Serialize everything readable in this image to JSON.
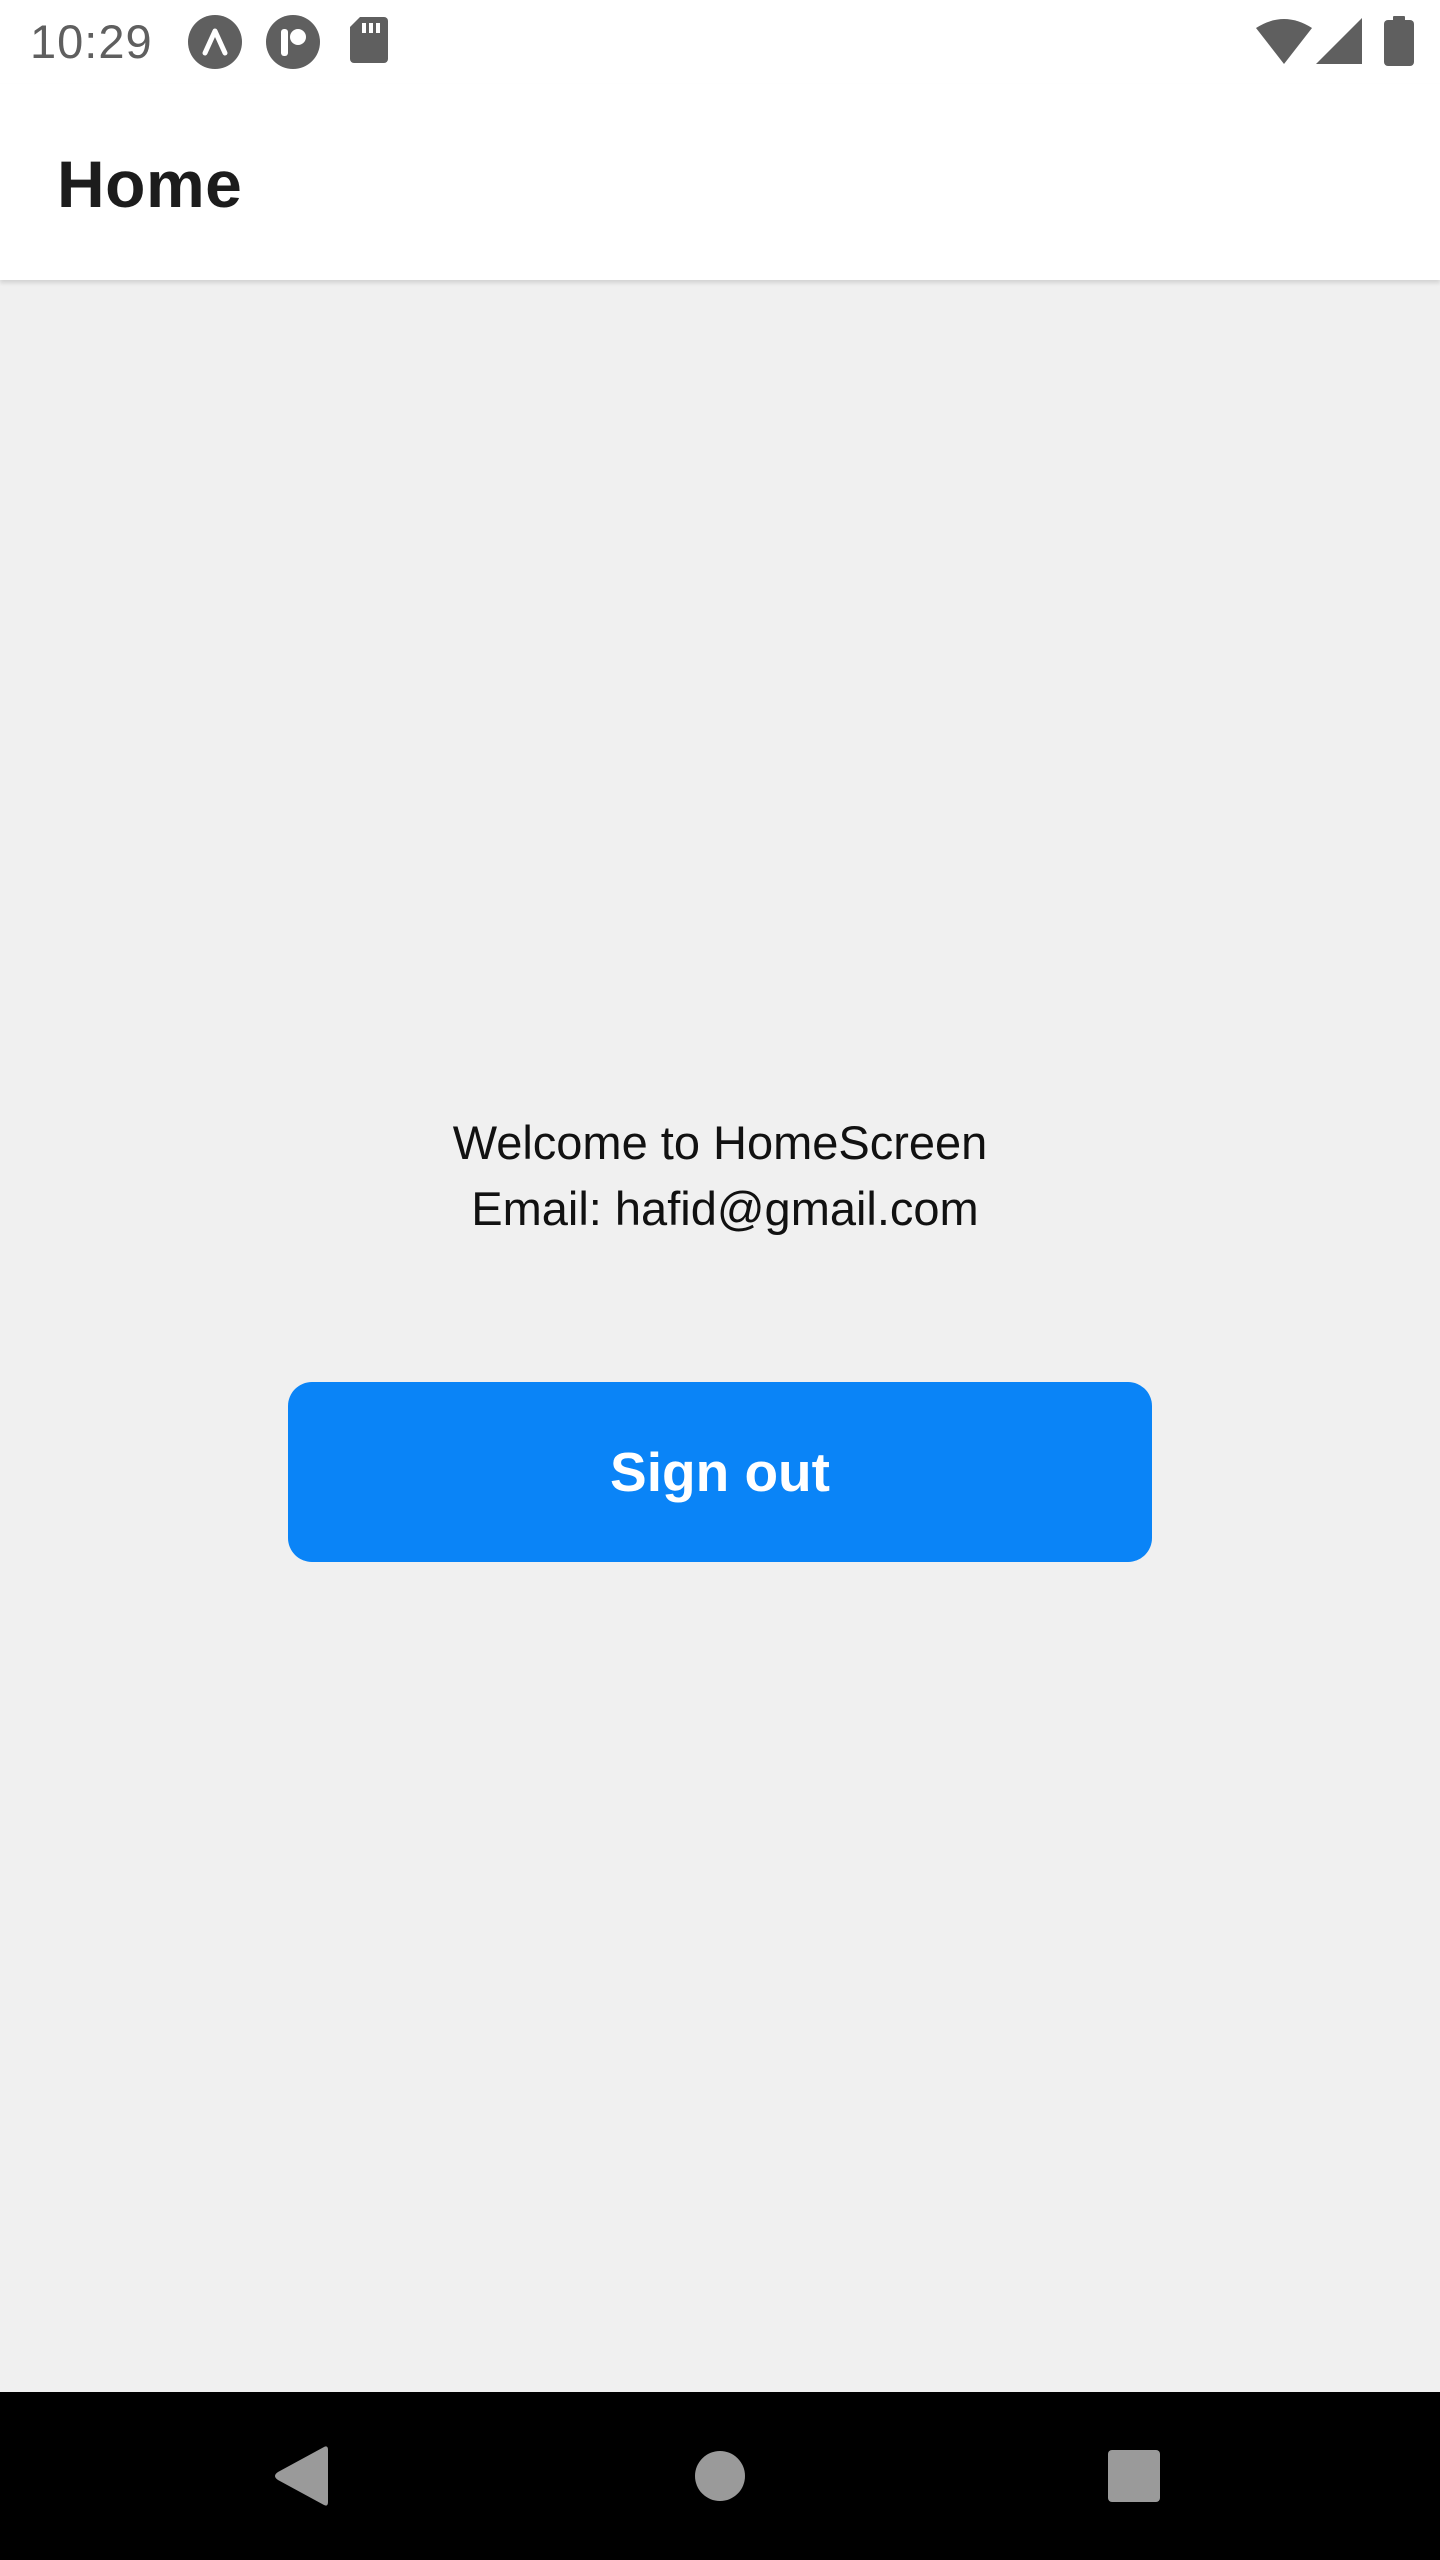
{
  "status_bar": {
    "time": "10:29",
    "icons_left": [
      "expo-go-icon",
      "react-devtools-icon",
      "sd-card-icon"
    ],
    "icons_right": [
      "wifi-icon",
      "cell-signal-icon",
      "battery-icon"
    ]
  },
  "header": {
    "title": "Home"
  },
  "main": {
    "welcome_text": "Welcome to HomeScreen",
    "email_text": "Email: hafid@gmail.com",
    "signout_label": "Sign out"
  },
  "nav_bar": {
    "buttons": [
      "back-icon",
      "home-icon",
      "recents-icon"
    ]
  },
  "colors": {
    "accent": "#0a84f7",
    "background": "#f0f0f0",
    "header": "#ffffff",
    "nav_bar": "#000000"
  }
}
